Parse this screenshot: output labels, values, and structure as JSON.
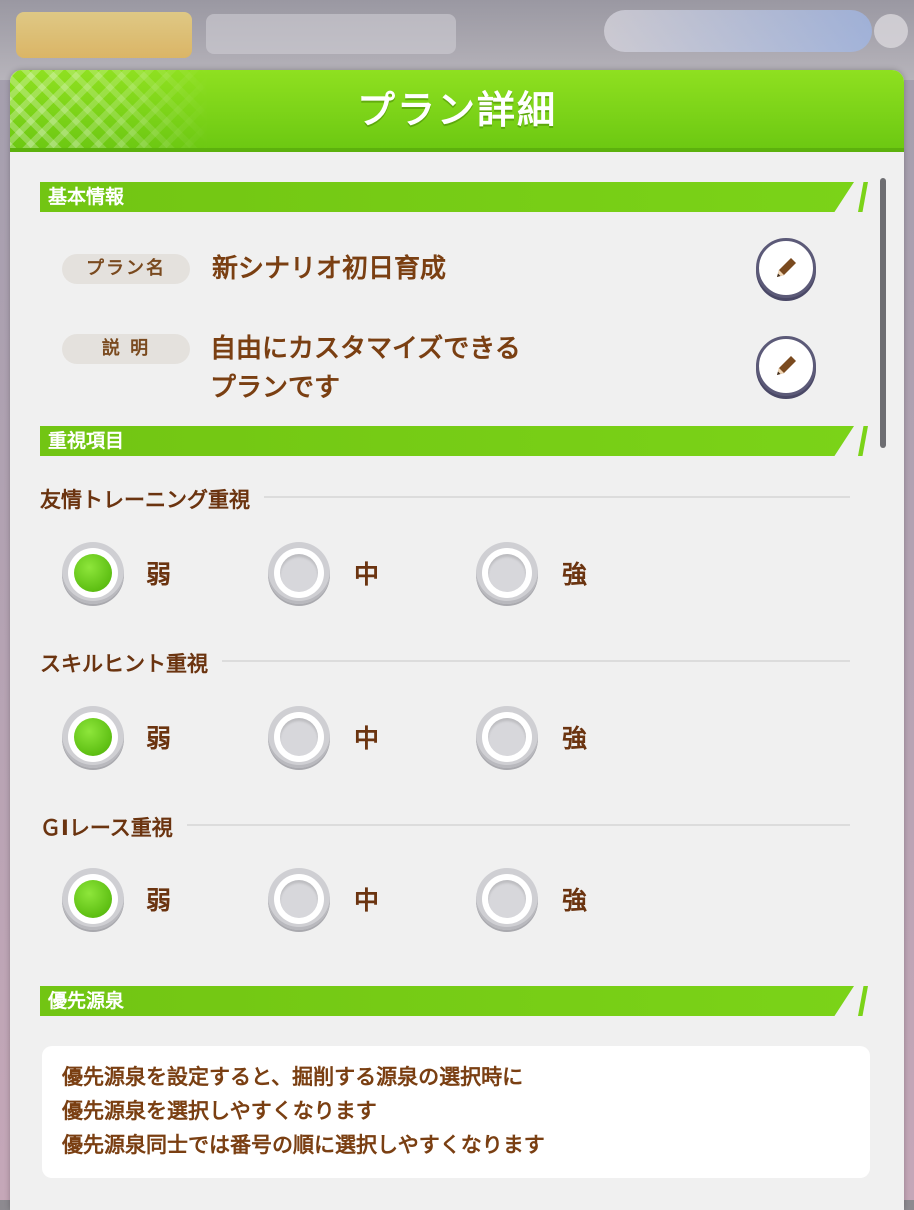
{
  "dialog": {
    "title": "プラン詳細"
  },
  "sections": {
    "basic": {
      "title": "基本情報",
      "plan_name_label": "プラン名",
      "plan_name_value": "新シナリオ初日育成",
      "description_label": "説 明",
      "description_line1": "自由にカスタマイズできる",
      "description_line2": "プランです"
    },
    "priority": {
      "title": "重視項目",
      "groups": [
        {
          "heading": "友情トレーニング重視",
          "options": [
            "弱",
            "中",
            "強"
          ],
          "selected": "弱"
        },
        {
          "heading": "スキルヒント重視",
          "options": [
            "弱",
            "中",
            "強"
          ],
          "selected": "弱"
        },
        {
          "heading": "ＧⅠレース重視",
          "options": [
            "弱",
            "中",
            "強"
          ],
          "selected": "弱"
        }
      ]
    },
    "source": {
      "title": "優先源泉",
      "note_lines": [
        "優先源泉を設定すると、掘削する源泉の選択時に",
        "優先源泉を選択しやすくなります",
        "優先源泉同士では番号の順に選択しやすくなります"
      ]
    }
  },
  "icons": {
    "edit": "pencil-icon"
  },
  "colors": {
    "accent_green": "#72c513",
    "text_brown": "#7a3f12",
    "selected_green": "#5ebf13"
  }
}
